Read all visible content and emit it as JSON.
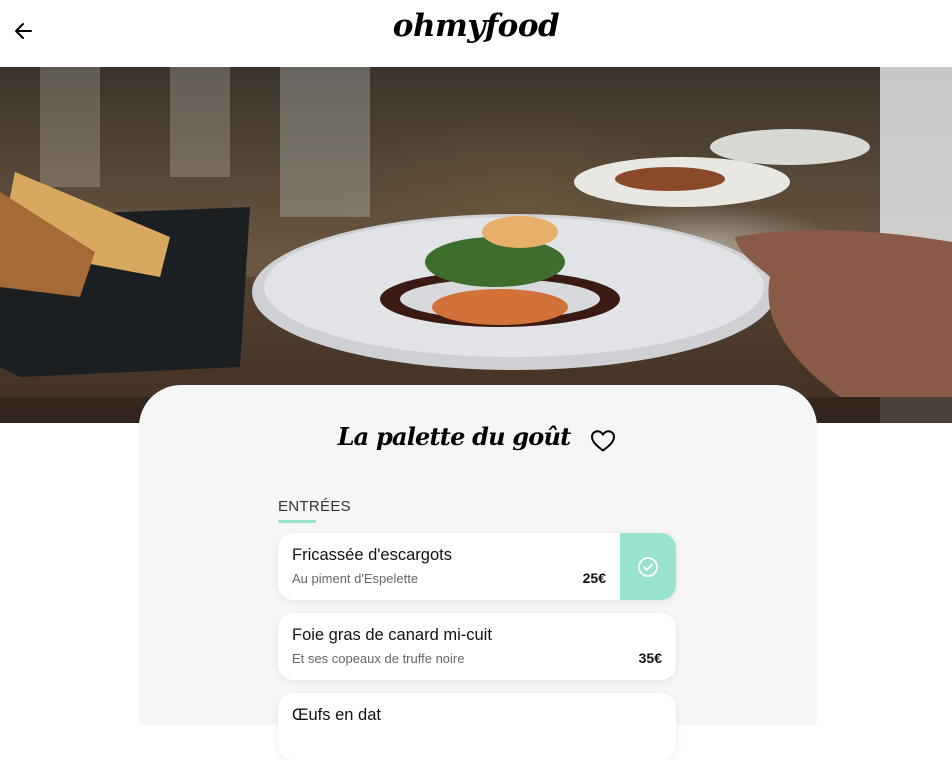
{
  "header": {
    "logo": "ohmyfood",
    "back_icon": "arrow-left-icon"
  },
  "hero": {
    "image": "restaurant-dish-photo"
  },
  "restaurant": {
    "name": "La palette du goût",
    "favorite_icon": "heart-outline-icon"
  },
  "menu": {
    "section_title": "ENTRÉES",
    "dishes": [
      {
        "name": "Fricassée d'escargots",
        "description": "Au piment d'Espelette",
        "price": "25€",
        "selected": true
      },
      {
        "name": "Foie gras de canard mi-cuit",
        "description": "Et ses copeaux de truffe noire",
        "price": "35€",
        "selected": false
      },
      {
        "name": "Œufs en dat",
        "description": "",
        "price": "",
        "selected": false
      }
    ]
  },
  "colors": {
    "accent": "#99e2d0",
    "card_background": "#f6f6f6",
    "text": "#111111"
  }
}
